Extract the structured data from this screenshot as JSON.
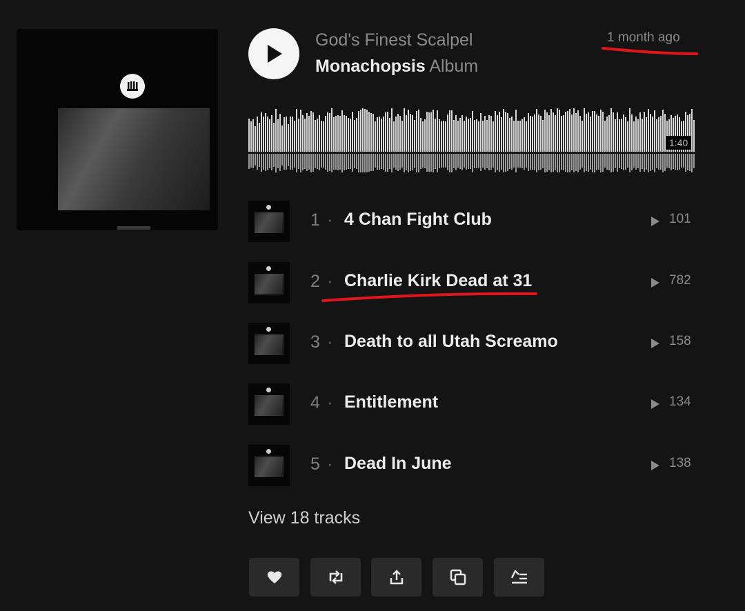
{
  "header": {
    "artist": "God's Finest Scalpel",
    "album_title": "Monachopsis",
    "album_type": "Album",
    "posted": "1 month ago"
  },
  "player": {
    "duration": "1:40"
  },
  "tracks": [
    {
      "number": "1",
      "separator": "·",
      "title": "4 Chan Fight Club",
      "plays": "101"
    },
    {
      "number": "2",
      "separator": "·",
      "title": "Charlie Kirk Dead at 31",
      "plays": "782"
    },
    {
      "number": "3",
      "separator": "·",
      "title": "Death to all Utah Screamo",
      "plays": "158"
    },
    {
      "number": "4",
      "separator": "·",
      "title": "Entitlement",
      "plays": "134"
    },
    {
      "number": "5",
      "separator": "·",
      "title": "Dead In June",
      "plays": "138"
    }
  ],
  "view_tracks": "View 18 tracks",
  "actions": [
    "heart-icon",
    "repost-icon",
    "share-icon",
    "copy-link-icon",
    "add-to-queue-icon"
  ],
  "colors": {
    "annotation": "#e0161b",
    "background": "#141414",
    "button": "#2a2a2a"
  }
}
